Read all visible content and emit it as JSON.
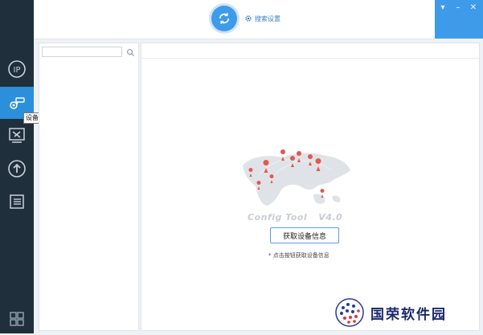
{
  "nav": {
    "items": [
      {
        "icon": "ip-icon"
      },
      {
        "icon": "camera-settings-icon",
        "active": true
      },
      {
        "icon": "tools-icon"
      },
      {
        "icon": "upgrade-icon"
      },
      {
        "icon": "list-icon"
      }
    ],
    "tooltip": "设备配置",
    "bottom_icon": "puzzle-icon"
  },
  "header": {
    "search_settings_label": "搜索设置"
  },
  "left_panel": {
    "search_placeholder": ""
  },
  "main": {
    "brand_name": "Config Tool",
    "brand_version": "V4.0",
    "get_info_button": "获取设备信息",
    "hint": "* 点击按钮获取设备信息"
  },
  "watermark": {
    "text": "国荣软件园"
  },
  "colors": {
    "nav_bg": "#1f2f3c",
    "accent": "#3d9be9",
    "pin": "#e05a4f"
  }
}
